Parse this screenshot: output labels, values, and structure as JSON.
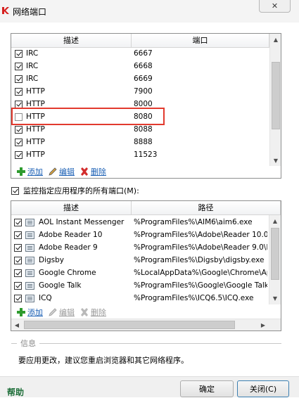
{
  "window": {
    "title": "网络端口",
    "close_glyph": "✕"
  },
  "ports": {
    "columns": [
      "描述",
      "端口"
    ],
    "rows": [
      {
        "checked": true,
        "desc": "IRC",
        "port": "6667"
      },
      {
        "checked": true,
        "desc": "IRC",
        "port": "6668"
      },
      {
        "checked": true,
        "desc": "IRC",
        "port": "6669"
      },
      {
        "checked": true,
        "desc": "HTTP",
        "port": "7900"
      },
      {
        "checked": true,
        "desc": "HTTP",
        "port": "8000"
      },
      {
        "checked": false,
        "desc": "HTTP",
        "port": "8080"
      },
      {
        "checked": true,
        "desc": "HTTP",
        "port": "8088"
      },
      {
        "checked": true,
        "desc": "HTTP",
        "port": "8888"
      },
      {
        "checked": true,
        "desc": "HTTP",
        "port": "11523"
      }
    ],
    "toolbar": {
      "add": "添加",
      "edit": "编辑",
      "delete": "删除"
    }
  },
  "monitor_all": {
    "checked": true,
    "label": "监控指定应用程序的所有端口(M):"
  },
  "apps": {
    "columns": [
      "描述",
      "路径"
    ],
    "rows": [
      {
        "checked": true,
        "desc": "AOL Instant Messenger",
        "path": "%ProgramFiles%\\AIM6\\aim6.exe"
      },
      {
        "checked": true,
        "desc": "Adobe Reader 10",
        "path": "%ProgramFiles%\\Adobe\\Reader 10.0\\R"
      },
      {
        "checked": true,
        "desc": "Adobe Reader 9",
        "path": "%ProgramFiles%\\Adobe\\Reader 9.0\\R"
      },
      {
        "checked": true,
        "desc": "Digsby",
        "path": "%ProgramFiles%\\Digsby\\digsby.exe"
      },
      {
        "checked": true,
        "desc": "Google Chrome",
        "path": "%LocalAppData%\\Google\\Chrome\\Ap"
      },
      {
        "checked": true,
        "desc": "Google Talk",
        "path": "%ProgramFiles%\\Google\\Google Talk"
      },
      {
        "checked": true,
        "desc": "ICQ",
        "path": "%ProgramFiles%\\ICQ6.5\\ICQ.exe"
      }
    ],
    "toolbar": {
      "add": "添加",
      "edit": "编辑",
      "delete": "删除"
    }
  },
  "info": {
    "heading": "信息",
    "text": "要应用更改，建议您重启浏览器和其它网络程序。"
  },
  "footer": {
    "help": "帮助",
    "ok": "确定",
    "close": "关闭(C)"
  },
  "colors": {
    "highlight": "#e23a2e",
    "link": "#1a5fb4",
    "help": "#1f6f3a"
  },
  "icons": {
    "app": "kaspersky-k-icon",
    "add": "green-plus-icon",
    "edit": "pencil-icon",
    "delete": "red-x-icon",
    "program": "program-window-icon"
  }
}
